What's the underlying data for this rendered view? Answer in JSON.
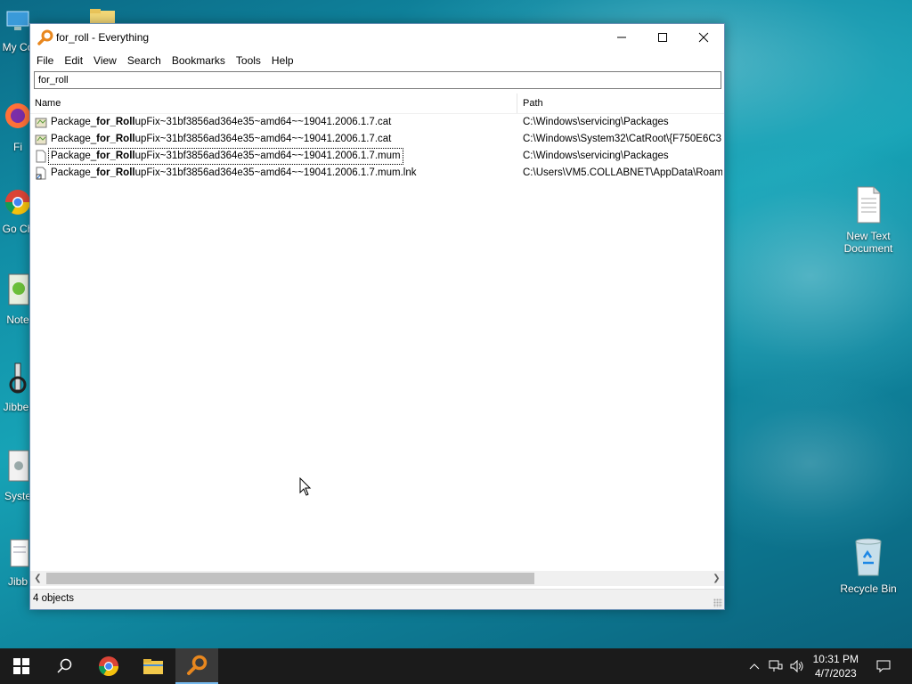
{
  "desktop": {
    "icons_left": [
      {
        "label": "My Co",
        "icon": "this-pc-icon"
      },
      {
        "label": "Fi",
        "icon": "firefox-icon"
      },
      {
        "label": "Go Ch",
        "icon": "chrome-icon"
      },
      {
        "label": "Note",
        "icon": "notepad-icon"
      },
      {
        "label": "Jibber",
        "icon": "jibber-icon"
      },
      {
        "label": "Syste",
        "icon": "system-icon"
      },
      {
        "label": "Jibb",
        "icon": "jibber-doc-icon"
      }
    ],
    "new_text_document": "New Text Document",
    "recycle_bin": "Recycle Bin"
  },
  "window": {
    "title": "for_roll - Everything",
    "menu": [
      "File",
      "Edit",
      "View",
      "Search",
      "Bookmarks",
      "Tools",
      "Help"
    ],
    "search_value": "for_roll",
    "columns": {
      "name": "Name",
      "path": "Path"
    },
    "rows": [
      {
        "name_pre": "Package_",
        "name_hl": "for_Roll",
        "name_post": "upFix~31bf3856ad364e35~amd64~~19041.2006.1.7.cat",
        "path": "C:\\Windows\\servicing\\Packages",
        "icon": "catalog-file-icon"
      },
      {
        "name_pre": "Package_",
        "name_hl": "for_Roll",
        "name_post": "upFix~31bf3856ad364e35~amd64~~19041.2006.1.7.cat",
        "path": "C:\\Windows\\System32\\CatRoot\\{F750E6C3",
        "icon": "catalog-file-icon"
      },
      {
        "name_pre": "Package_",
        "name_hl": "for_Roll",
        "name_post": "upFix~31bf3856ad364e35~amd64~~19041.2006.1.7.mum",
        "path": "C:\\Windows\\servicing\\Packages",
        "icon": "blank-file-icon"
      },
      {
        "name_pre": "Package_",
        "name_hl": "for_Roll",
        "name_post": "upFix~31bf3856ad364e35~amd64~~19041.2006.1.7.mum.lnk",
        "path": "C:\\Users\\VM5.COLLABNET\\AppData\\Roam",
        "icon": "shortcut-file-icon"
      }
    ],
    "status": "4 objects"
  },
  "taskbar": {
    "clock_time": "10:31 PM",
    "clock_date": "4/7/2023"
  },
  "colors": {
    "accent": "#76b9ed",
    "taskbar": "#1b1b1b",
    "everything_orange": "#e8871e"
  }
}
